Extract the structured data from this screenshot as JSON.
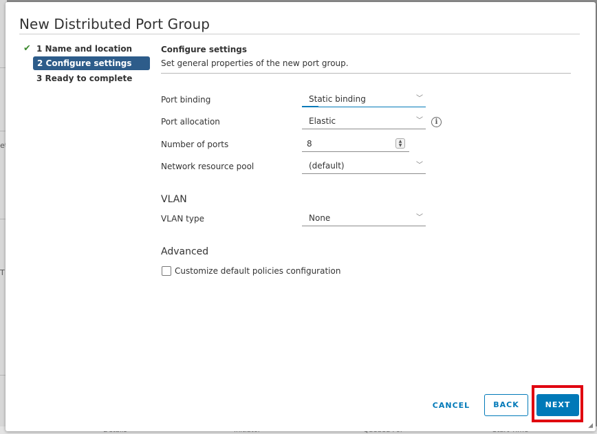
{
  "background": {
    "fragments": [
      "et",
      "T"
    ],
    "bottom_columns": [
      "Details",
      "Initiator",
      "Queued For",
      "Start Time"
    ]
  },
  "dialog": {
    "title": "New Distributed Port Group"
  },
  "steps": [
    {
      "label": "1 Name and location",
      "status": "complete",
      "icon": "check-icon"
    },
    {
      "label": "2 Configure settings",
      "status": "active"
    },
    {
      "label": "3 Ready to complete",
      "status": "pending"
    }
  ],
  "configure": {
    "heading": "Configure settings",
    "description": "Set general properties of the new port group."
  },
  "fields": {
    "port_binding": {
      "label": "Port binding",
      "value": "Static binding"
    },
    "port_allocation": {
      "label": "Port allocation",
      "value": "Elastic",
      "info_icon": "info-icon"
    },
    "number_of_ports": {
      "label": "Number of ports",
      "value": "8"
    },
    "network_resource_pool": {
      "label": "Network resource pool",
      "value": "(default)"
    }
  },
  "vlan": {
    "heading": "VLAN",
    "type_label": "VLAN type",
    "type_value": "None"
  },
  "advanced": {
    "heading": "Advanced",
    "customize_label": "Customize default policies configuration",
    "customize_checked": false
  },
  "footer": {
    "cancel_label": "CANCEL",
    "back_label": "BACK",
    "next_label": "NEXT"
  },
  "colors": {
    "accent": "#0079b8",
    "active_step": "#2d5c8a",
    "complete_check": "#3c8a2e",
    "highlight_box": "#e0000f"
  }
}
